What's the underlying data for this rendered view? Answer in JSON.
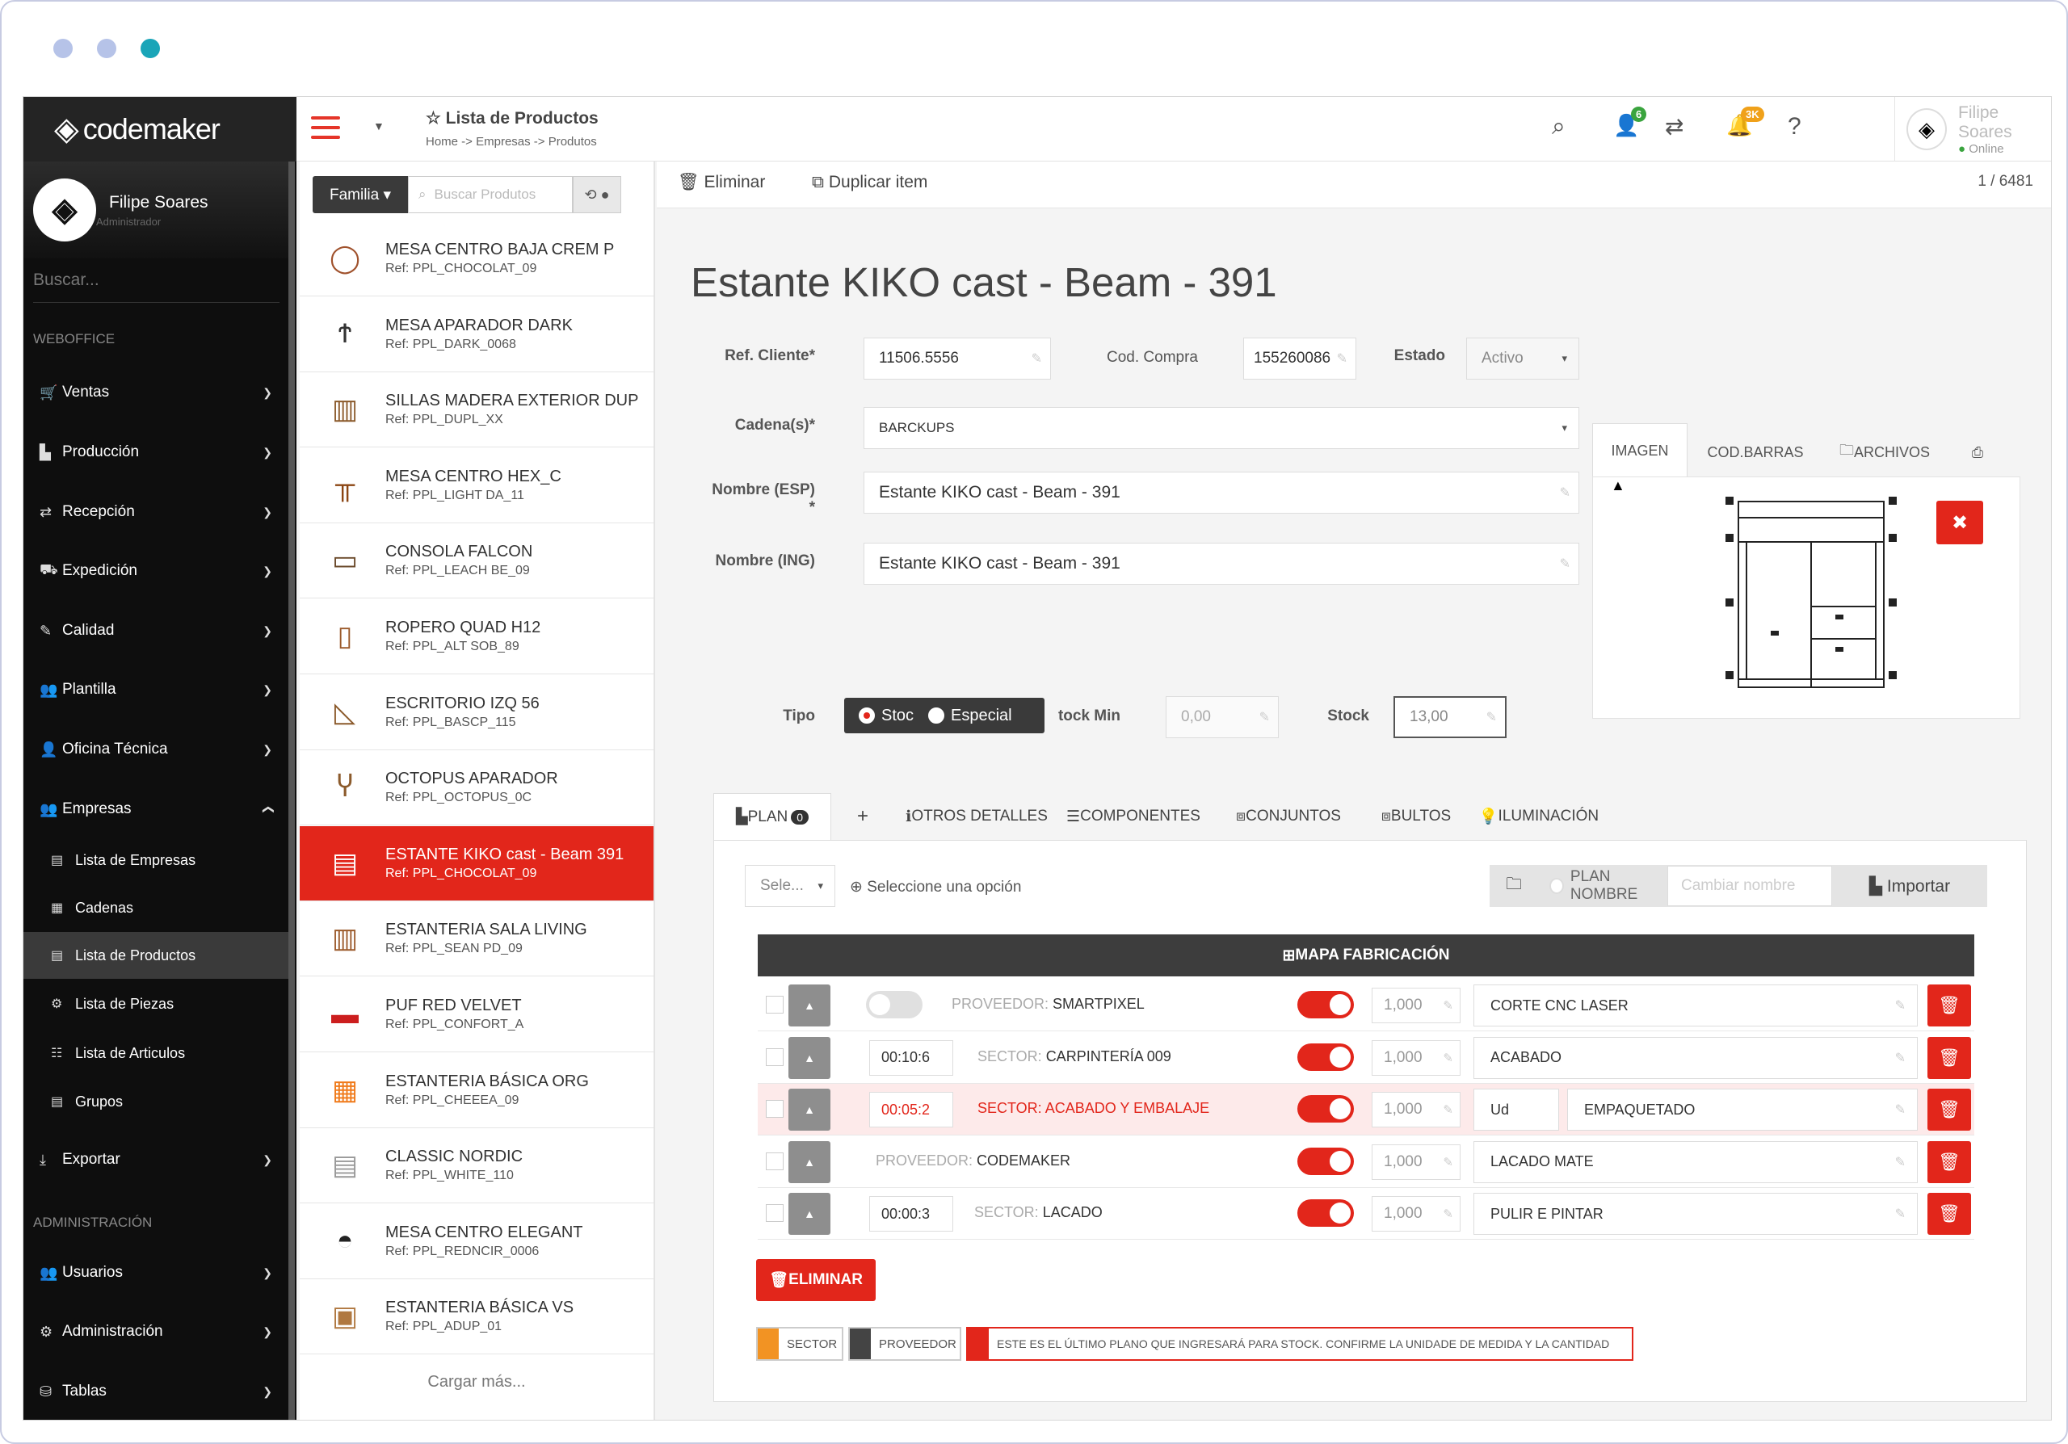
{
  "sidebar": {
    "brand": "codemaker",
    "user": {
      "name": "Filipe Soares",
      "role": "Administrador"
    },
    "search_placeholder": "Buscar...",
    "section_weboffice": "WEBOFFICE",
    "section_admin": "ADMINISTRACIÓN",
    "items": [
      {
        "label": "Ventas"
      },
      {
        "label": "Producción"
      },
      {
        "label": "Recepción"
      },
      {
        "label": "Expedición"
      },
      {
        "label": "Calidad"
      },
      {
        "label": "Plantilla"
      },
      {
        "label": "Oficina Técnica"
      },
      {
        "label": "Empresas"
      }
    ],
    "empresas_sub": [
      {
        "label": "Lista de Empresas"
      },
      {
        "label": "Cadenas"
      },
      {
        "label": "Lista de Productos"
      },
      {
        "label": "Lista de Piezas"
      },
      {
        "label": "Lista de Articulos"
      },
      {
        "label": "Grupos"
      }
    ],
    "exportar": "Exportar",
    "admin_items": [
      {
        "label": "Usuarios"
      },
      {
        "label": "Administración"
      },
      {
        "label": "Tablas"
      }
    ]
  },
  "topbar": {
    "title": "Lista de Productos",
    "breadcrumb": "Home -> Empresas -> Produtos",
    "badge_users": "6",
    "badge_notif": "3K",
    "user_name": "Filipe Soares",
    "user_status": "Online"
  },
  "list": {
    "family_label": "Familia ▾",
    "search_placeholder": "Buscar Produtos",
    "load_more": "Cargar más...",
    "products": [
      {
        "name": "MESA CENTRO BAJA CREM P",
        "ref": "Ref: PPL_CHOCOLAT_09"
      },
      {
        "name": "MESA APARADOR DARK",
        "ref": "Ref: PPL_DARK_0068"
      },
      {
        "name": "SILLAS MADERA EXTERIOR DUP",
        "ref": "Ref: PPL_DUPL_XX"
      },
      {
        "name": "MESA CENTRO HEX_C",
        "ref": "Ref: PPL_LIGHT DA_11"
      },
      {
        "name": "CONSOLA FALCON",
        "ref": "Ref: PPL_LEACH BE_09"
      },
      {
        "name": "ROPERO QUAD H12",
        "ref": "Ref: PPL_ALT SOB_89"
      },
      {
        "name": "ESCRITORIO IZQ 56",
        "ref": "Ref: PPL_BASCP_115"
      },
      {
        "name": "OCTOPUS APARADOR",
        "ref": "Ref: PPL_OCTOPUS_0C"
      },
      {
        "name": "ESTANTE KIKO cast - Beam 391",
        "ref": "Ref: PPL_CHOCOLAT_09"
      },
      {
        "name": "ESTANTERIA SALA LIVING",
        "ref": "Ref: PPL_SEAN PD_09"
      },
      {
        "name": "PUF RED VELVET",
        "ref": "Ref: PPL_CONFORT_A"
      },
      {
        "name": "ESTANTERIA BÁSICA ORG",
        "ref": "Ref: PPL_CHEEEA_09"
      },
      {
        "name": "CLASSIC NORDIC",
        "ref": "Ref: PPL_WHITE_110"
      },
      {
        "name": "MESA CENTRO ELEGANT",
        "ref": "Ref: PPL_REDNCIR_0006"
      },
      {
        "name": "ESTANTERIA BÁSICA VS",
        "ref": "Ref: PPL_ADUP_01"
      }
    ]
  },
  "actions": {
    "delete": "Eliminar",
    "duplicate": "Duplicar item",
    "counter": "1 / 6481"
  },
  "detail": {
    "title": "Estante KIKO cast - Beam - 391",
    "ref_label": "Ref. Cliente*",
    "ref_value": "11506.5556",
    "cod_label": "Cod. Compra",
    "cod_value": "155260086",
    "estado_label": "Estado",
    "estado_value": "Activo",
    "cadena_label": "Cadena(s)*",
    "cadena_value": "BARCKUPS",
    "nombre_esp_label": "Nombre (ESP)",
    "nombre_esp_star": "*",
    "nombre_esp_value": "Estante KIKO cast - Beam - 391",
    "nombre_ing_label": "Nombre (ING)",
    "nombre_ing_value": "Estante KIKO cast - Beam - 391",
    "tipo_label": "Tipo",
    "tipo_stock": "Stoc",
    "tipo_especial": "Especial",
    "stockmin_label": "tock Min",
    "stockmin_value": "0,00",
    "stock_label": "Stock",
    "stock_value": "13,00",
    "img_tabs": [
      "IMAGEN",
      "COD.BARRAS",
      "ARCHIVOS"
    ]
  },
  "tabs": {
    "plan": "PLAN",
    "plan_count": "0",
    "add": "+",
    "others": "OTROS DETALLES",
    "components": "COMPONENTES",
    "sets": "CONJUNTOS",
    "packages": "BULTOS",
    "lighting": "ILUMINACIÓN"
  },
  "plan": {
    "select_label": "Sele...",
    "select_hint": "Seleccione una opción",
    "plan_nombre": "PLAN NOMBRE",
    "rename_placeholder": "Cambiar nombre",
    "import": "Importar",
    "mapa": "MAPA FABRICACIÓN",
    "rows": [
      {
        "time": "",
        "kind": "PROVEEDOR: ",
        "name": "SMARTPIXEL",
        "qty": "1,000",
        "unit": "",
        "op": "CORTE CNC LASER"
      },
      {
        "time": "00:10:6",
        "kind": "SECTOR: ",
        "name": "CARPINTERÍA 009",
        "qty": "1,000",
        "unit": "",
        "op": "ACABADO"
      },
      {
        "time": "00:05:2",
        "kind": "SECTOR: ",
        "name": "ACABADO Y EMBALAJE",
        "qty": "1,000",
        "unit": "Ud",
        "op": "EMPAQUETADO"
      },
      {
        "time": "",
        "kind": "PROVEEDOR: ",
        "name": "CODEMAKER",
        "qty": "1,000",
        "unit": "",
        "op": "LACADO MATE"
      },
      {
        "time": "00:00:3",
        "kind": "SECTOR: ",
        "name": "LACADO",
        "qty": "1,000",
        "unit": "",
        "op": "PULIR E PINTAR"
      }
    ],
    "delete_btn": "ELIMINAR",
    "legend_sector": "SECTOR",
    "legend_proveedor": "PROVEEDOR",
    "legend_warning": "ESTE ES EL ÚLTIMO PLANO QUE INGRESARÁ PARA STOCK. CONFIRME LA UNIDADE DE MEDIDA Y LA CANTIDAD"
  },
  "colors": {
    "accent": "#e2261b",
    "dark": "#0e0e0e",
    "window_dots": [
      "#b6c3e8",
      "#b6c3e8",
      "#1aa5b8"
    ]
  }
}
